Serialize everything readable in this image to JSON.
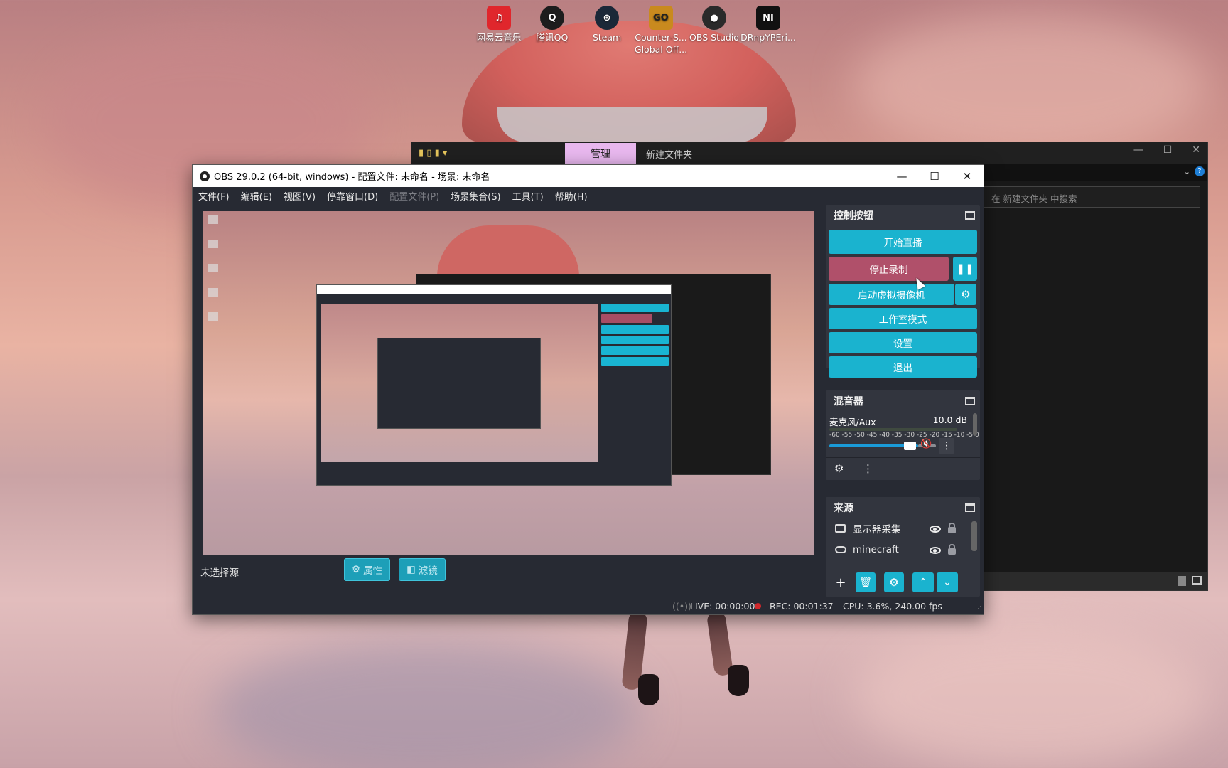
{
  "desktop": {
    "icons": [
      {
        "label": "网易云音乐",
        "glyph": "♫",
        "color": "#e0262c"
      },
      {
        "label": "腾讯QQ",
        "glyph": "Q",
        "color": "#1d1d1d"
      },
      {
        "label": "Steam",
        "glyph": "⊛",
        "color": "#1b2838"
      },
      {
        "label": "Counter-S... Global Off...",
        "glyph": "GO",
        "color": "#c98a1e"
      },
      {
        "label": "OBS Studio",
        "glyph": "●",
        "color": "#2a2a2a"
      },
      {
        "label": "DRnpYPEri...",
        "glyph": "NI",
        "color": "#111111"
      }
    ]
  },
  "explorer": {
    "tab_label": "管理",
    "folder_title": "新建文件夹",
    "search_placeholder": "在 新建文件夹 中搜索",
    "min": "—",
    "max": "☐",
    "close": "✕"
  },
  "obs": {
    "title": "OBS 29.0.2 (64-bit, windows) - 配置文件: 未命名 - 场景: 未命名",
    "min": "—",
    "max": "☐",
    "close": "✕",
    "menu": [
      "文件(F)",
      "编辑(E)",
      "视图(V)",
      "停靠窗口(D)",
      "配置文件(P)",
      "场景集合(S)",
      "工具(T)",
      "帮助(H)"
    ],
    "no_source": "未选择源",
    "properties_label": "属性",
    "filters_label": "滤镜",
    "status": {
      "live": "LIVE: 00:00:00",
      "rec": "REC: 00:01:37",
      "cpu": "CPU: 3.6%, 240.00 fps"
    },
    "controls": {
      "header": "控制按钮",
      "start_stream": "开始直播",
      "stop_record": "停止录制",
      "virtual_cam": "启动虚拟摄像机",
      "studio_mode": "工作室模式",
      "settings": "设置",
      "exit": "退出"
    },
    "mixer": {
      "header": "混音器",
      "channel": "麦克风/Aux",
      "db": "10.0 dB",
      "scale": "-60 -55 -50 -45 -40 -35 -30 -25 -20 -15 -10 -5 0",
      "volume_level": 0.82,
      "muted": true
    },
    "sources": {
      "header": "来源",
      "items": [
        {
          "name": "显示器采集",
          "kind": "monitor"
        },
        {
          "name": "minecraft",
          "kind": "gamepad"
        }
      ]
    },
    "colors": {
      "accent": "#1ab3cf",
      "record": "#b0506a"
    }
  }
}
